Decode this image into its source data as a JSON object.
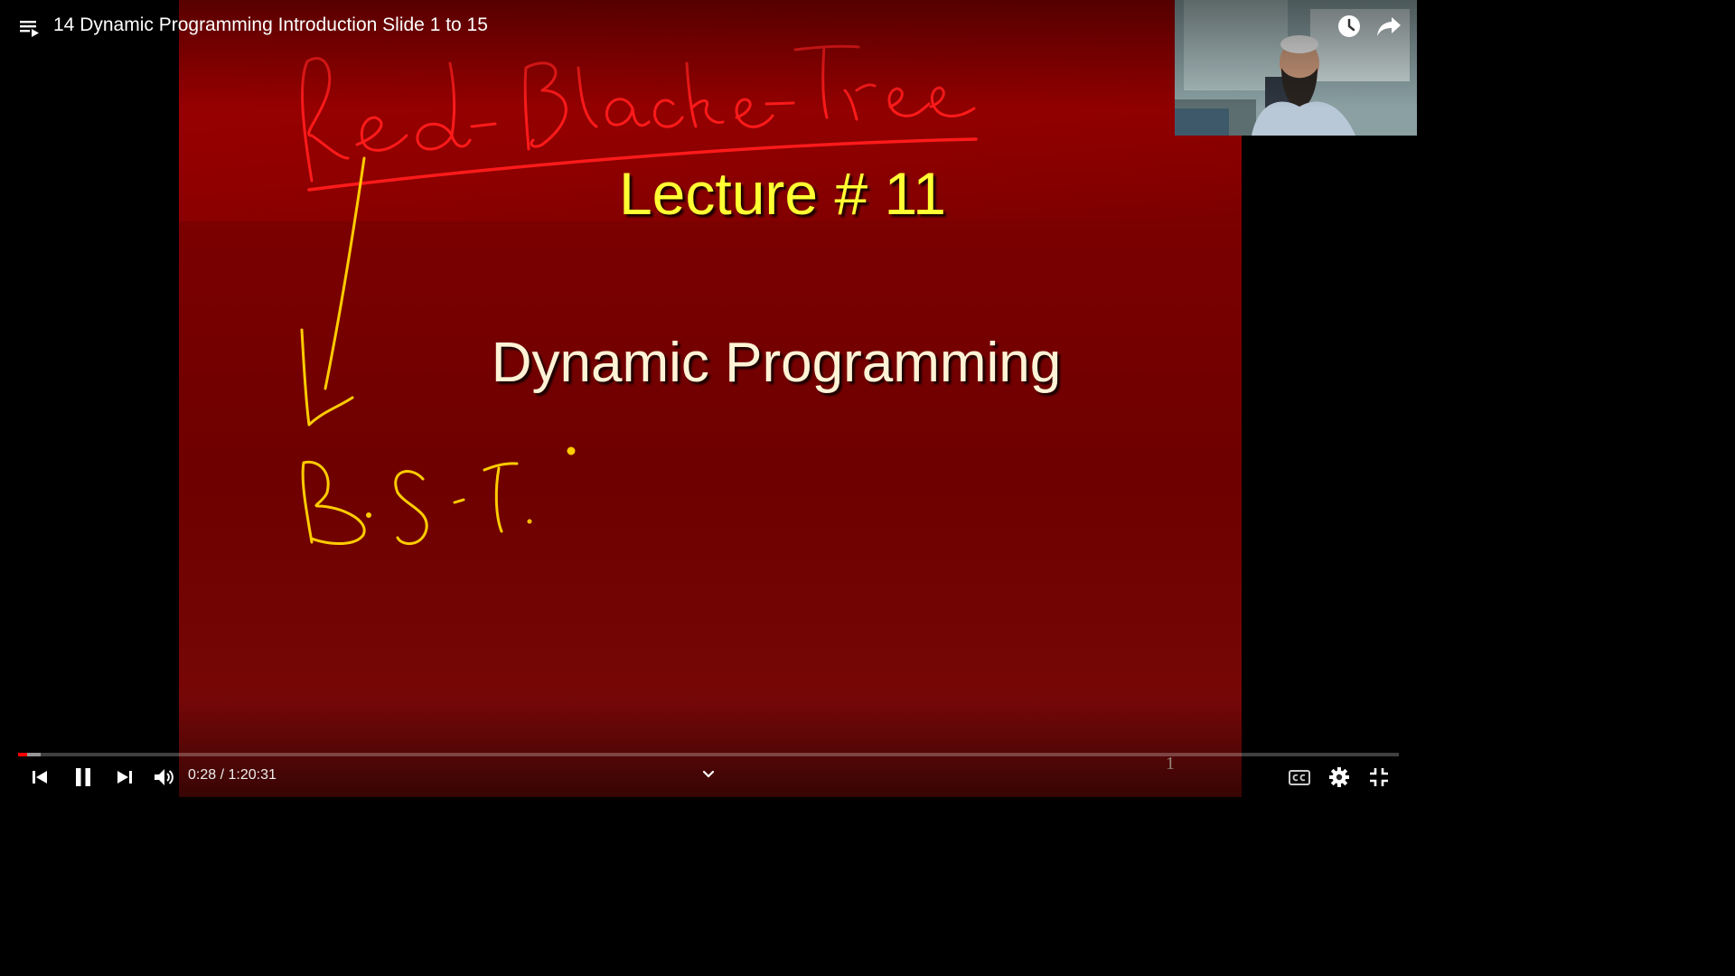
{
  "player": {
    "title": "14 Dynamic Programming Introduction Slide 1 to 15",
    "time_current": "0:28",
    "time_separator": " / ",
    "time_total": "1:20:31",
    "progress_played_fraction": 0.006,
    "progress_buffered_fraction": 0.016
  },
  "slide": {
    "lecture_title": "Lecture # 11",
    "heading": "Dynamic Programming",
    "page_number": "1"
  },
  "annotations": {
    "handwriting_top": "Red-Black-Tree",
    "handwriting_bottom": "B.S-T",
    "colors": {
      "red_ink": "#ff1a1a",
      "yellow_ink": "#ffcc00"
    }
  },
  "icons": {
    "playlist": "playlist-icon",
    "watch_later": "clock-icon",
    "share": "share-icon",
    "previous": "skip-previous-icon",
    "pause": "pause-icon",
    "next": "skip-next-icon",
    "volume": "volume-icon",
    "chevron": "chevron-down-icon",
    "captions": "captions-icon",
    "settings": "gear-icon",
    "fullscreen_exit": "fullscreen-exit-icon"
  },
  "colors": {
    "progress": "#ff0000",
    "slide_bg": "#7a0000",
    "title_yellow": "#ffff33"
  }
}
